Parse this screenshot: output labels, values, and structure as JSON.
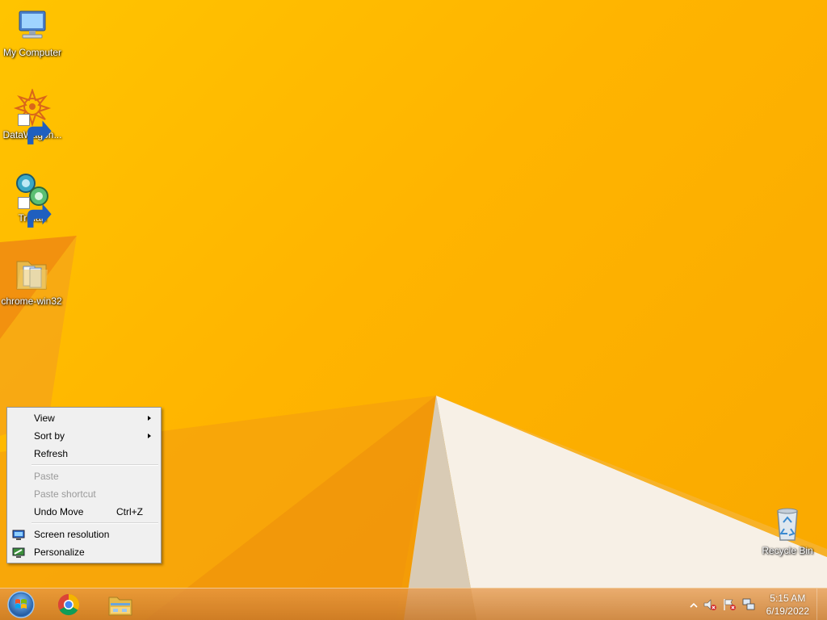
{
  "desktop_icons": [
    {
      "label": "My Computer",
      "icon": "computer-icon"
    },
    {
      "label": "DataWagon...",
      "icon": "datawagon-icon"
    },
    {
      "label": "Trillian",
      "icon": "trillian-icon"
    },
    {
      "label": "chrome-win32",
      "icon": "folder-icon"
    },
    {
      "label": "Recycle Bin",
      "icon": "recycle-bin-icon"
    }
  ],
  "context_menu": {
    "view": "View",
    "sort_by": "Sort by",
    "refresh": "Refresh",
    "paste": "Paste",
    "paste_shortcut": "Paste shortcut",
    "undo_move": "Undo Move",
    "undo_move_shortcut": "Ctrl+Z",
    "screen_resolution": "Screen resolution",
    "personalize": "Personalize"
  },
  "taskbar": {
    "apps": [
      {
        "name": "Google Chrome",
        "icon": "chrome-icon"
      },
      {
        "name": "File Explorer",
        "icon": "file-explorer-icon"
      }
    ],
    "clock": {
      "time": "5:15 AM",
      "date": "6/19/2022"
    }
  },
  "colors": {
    "wallpaper": "#ffb400",
    "menu_bg": "#f0f0f0",
    "disabled_text": "#9a9a9a"
  }
}
